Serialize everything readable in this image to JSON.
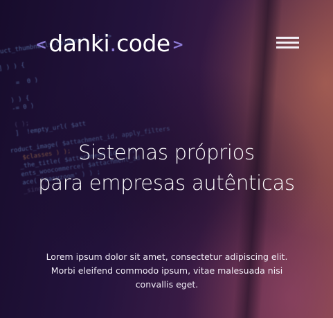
{
  "brand": {
    "left_bracket": "<",
    "name_part1": "danki",
    "dot": ".",
    "name_part2": "code",
    "right_bracket": ">"
  },
  "header": {
    "menu_icon": "hamburger-menu-icon"
  },
  "hero": {
    "headline_line1": "Sistemas próprios",
    "headline_line2": "para empresas autênticas",
    "subtext": "Lorem ipsum dolor sit amet, consectetur adipiscing elit. Morbi eleifend commodo ipsum, vitae malesuada nisi convallis eget."
  },
  "colors": {
    "accent": "#8d7bd6",
    "text": "#ffffff",
    "background_dark": "#1b1030"
  },
  "background_code": [
    "duct_thumbnails_columns', ); ?>",
    "",
    "] ) ) {",
    "",
    "    =  0 )",
    "",
    "  ) ) {",
    "  -= 0 )",
    "",
    "  ( );",
    "  ]  !empty_url( $att",
    "",
    "roduct_image( $attachment_id, apply_filters",
    "   $classes ) );",
    "  _the_title( $attachment_id ) );",
    "  ents_woocommerce( $attachment_id",
    "  ace( 'easyzoom' ) ) ;",
    "  _single' ) ) );"
  ]
}
